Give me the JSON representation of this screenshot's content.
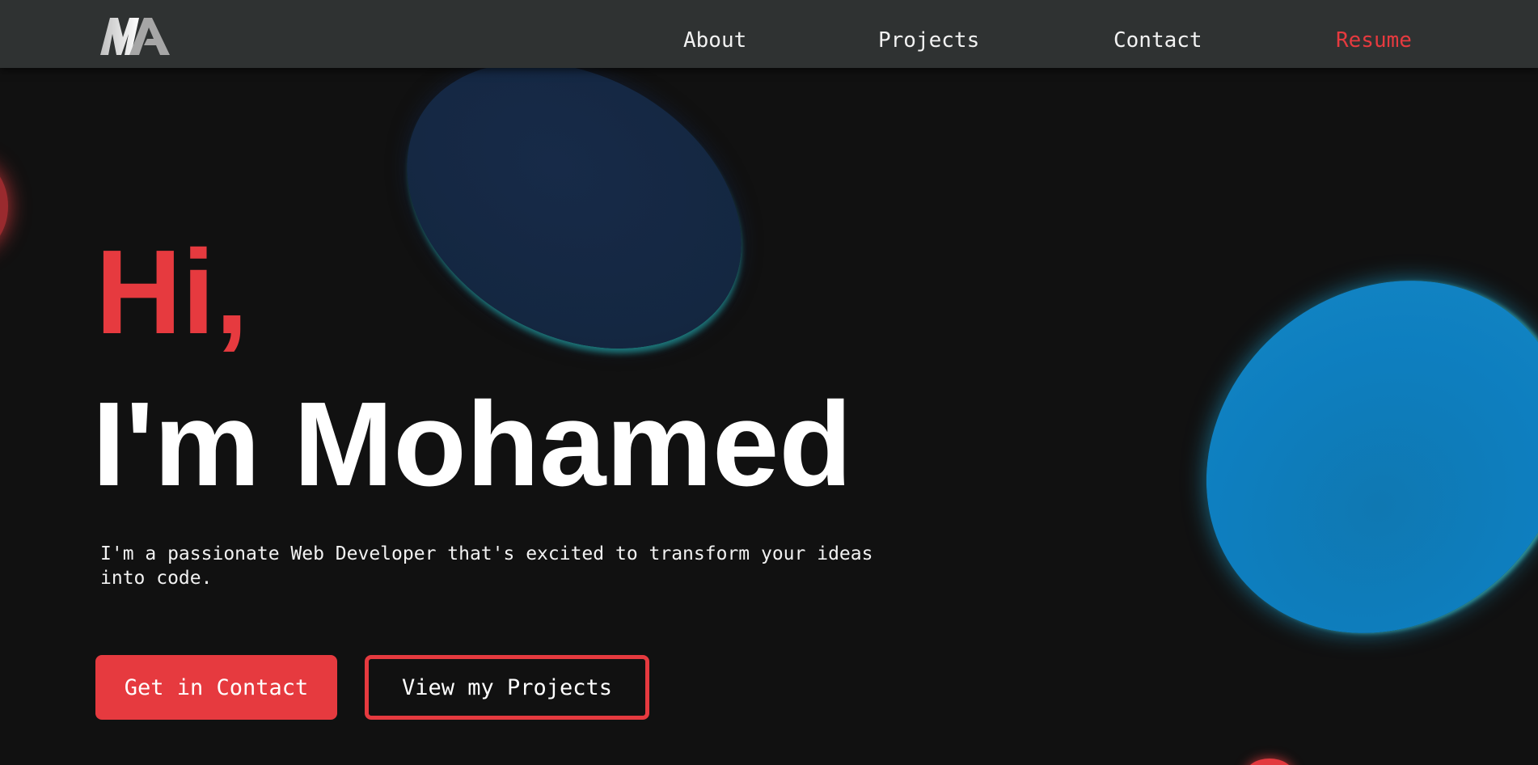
{
  "brand": {
    "logo_text": "MA",
    "accent_color": "#e63a3f",
    "background_color": "#111111",
    "navbar_color": "#2f3232"
  },
  "nav": {
    "about": "About",
    "projects": "Projects",
    "contact": "Contact",
    "resume": "Resume"
  },
  "hero": {
    "greeting": "Hi,",
    "name": "I'm Mohamed",
    "description": "I'm a passionate Web Developer that's excited to transform your ideas into code.",
    "primary_button": "Get in Contact",
    "secondary_button": "View my Projects"
  }
}
